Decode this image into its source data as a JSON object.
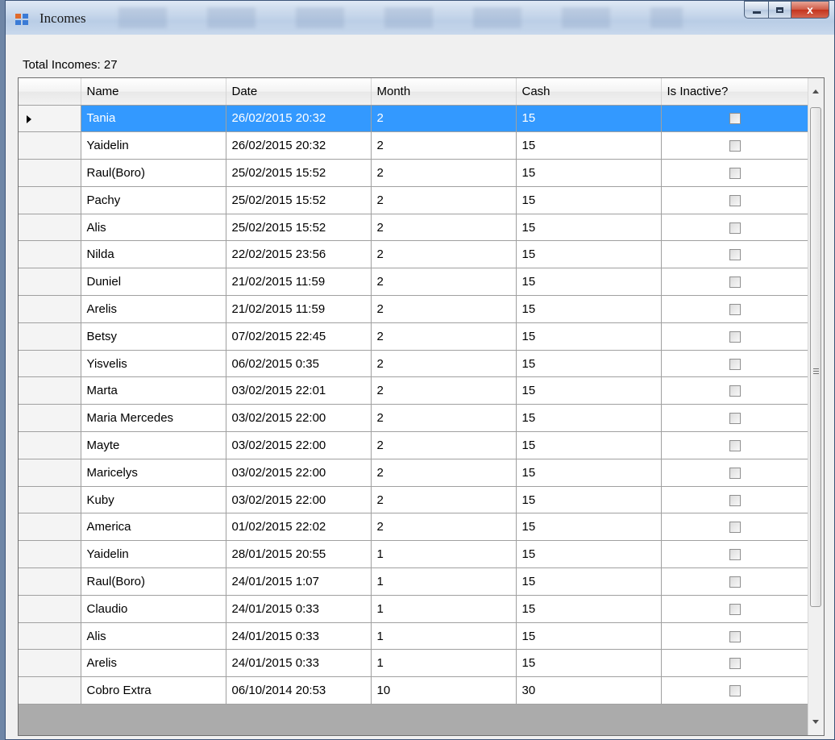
{
  "window": {
    "title": "Incomes",
    "close_glyph": "x"
  },
  "summary": {
    "total_label": "Total Incomes: 27"
  },
  "grid": {
    "columns": [
      "Name",
      "Date",
      "Month",
      "Cash",
      "Is Inactive?"
    ],
    "selected_row": 0,
    "rows": [
      {
        "name": "Tania",
        "date": "26/02/2015 20:32",
        "month": "2",
        "cash": "15",
        "inactive": false
      },
      {
        "name": "Yaidelin",
        "date": "26/02/2015 20:32",
        "month": "2",
        "cash": "15",
        "inactive": false
      },
      {
        "name": "Raul(Boro)",
        "date": "25/02/2015 15:52",
        "month": "2",
        "cash": "15",
        "inactive": false
      },
      {
        "name": "Pachy",
        "date": "25/02/2015 15:52",
        "month": "2",
        "cash": "15",
        "inactive": false
      },
      {
        "name": "Alis",
        "date": "25/02/2015 15:52",
        "month": "2",
        "cash": "15",
        "inactive": false
      },
      {
        "name": "Nilda",
        "date": "22/02/2015 23:56",
        "month": "2",
        "cash": "15",
        "inactive": false
      },
      {
        "name": "Duniel",
        "date": "21/02/2015 11:59",
        "month": "2",
        "cash": "15",
        "inactive": false
      },
      {
        "name": "Arelis",
        "date": "21/02/2015 11:59",
        "month": "2",
        "cash": "15",
        "inactive": false
      },
      {
        "name": "Betsy",
        "date": "07/02/2015 22:45",
        "month": "2",
        "cash": "15",
        "inactive": false
      },
      {
        "name": "Yisvelis",
        "date": "06/02/2015 0:35",
        "month": "2",
        "cash": "15",
        "inactive": false
      },
      {
        "name": "Marta",
        "date": "03/02/2015 22:01",
        "month": "2",
        "cash": "15",
        "inactive": false
      },
      {
        "name": "Maria Mercedes",
        "date": "03/02/2015 22:00",
        "month": "2",
        "cash": "15",
        "inactive": false
      },
      {
        "name": "Mayte",
        "date": "03/02/2015 22:00",
        "month": "2",
        "cash": "15",
        "inactive": false
      },
      {
        "name": "Maricelys",
        "date": "03/02/2015 22:00",
        "month": "2",
        "cash": "15",
        "inactive": false
      },
      {
        "name": "Kuby",
        "date": "03/02/2015 22:00",
        "month": "2",
        "cash": "15",
        "inactive": false
      },
      {
        "name": "America",
        "date": "01/02/2015 22:02",
        "month": "2",
        "cash": "15",
        "inactive": false
      },
      {
        "name": "Yaidelin",
        "date": "28/01/2015 20:55",
        "month": "1",
        "cash": "15",
        "inactive": false
      },
      {
        "name": "Raul(Boro)",
        "date": "24/01/2015 1:07",
        "month": "1",
        "cash": "15",
        "inactive": false
      },
      {
        "name": "Claudio",
        "date": "24/01/2015 0:33",
        "month": "1",
        "cash": "15",
        "inactive": false
      },
      {
        "name": "Alis",
        "date": "24/01/2015 0:33",
        "month": "1",
        "cash": "15",
        "inactive": false
      },
      {
        "name": "Arelis",
        "date": "24/01/2015 0:33",
        "month": "1",
        "cash": "15",
        "inactive": false
      },
      {
        "name": "Cobro Extra",
        "date": "06/10/2014 20:53",
        "month": "10",
        "cash": "30",
        "inactive": false
      }
    ]
  }
}
